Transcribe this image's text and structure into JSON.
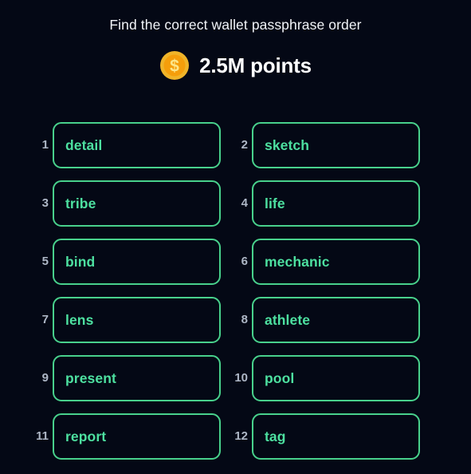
{
  "header": {
    "title": "Find the correct wallet passphrase order",
    "points_label": "2.5M points",
    "coin_icon": "dollar-coin-icon",
    "coin_symbol": "$"
  },
  "colors": {
    "background": "#040815",
    "box_border": "#48d18c",
    "word_text": "#4de0a0",
    "index_text": "#aeb7c6",
    "title_text": "#f2f4f8",
    "points_text": "#ffffff",
    "coin_outer": "#f0b429",
    "coin_inner": "#f59e0b",
    "coin_symbol": "#fde68a"
  },
  "grid": {
    "columns": 2,
    "rows": 6,
    "entries": [
      {
        "index": "1",
        "word": "detail"
      },
      {
        "index": "2",
        "word": "sketch"
      },
      {
        "index": "3",
        "word": "tribe"
      },
      {
        "index": "4",
        "word": "life"
      },
      {
        "index": "5",
        "word": "bind"
      },
      {
        "index": "6",
        "word": "mechanic"
      },
      {
        "index": "7",
        "word": "lens"
      },
      {
        "index": "8",
        "word": "athlete"
      },
      {
        "index": "9",
        "word": "present"
      },
      {
        "index": "10",
        "word": "pool"
      },
      {
        "index": "11",
        "word": "report"
      },
      {
        "index": "12",
        "word": "tag"
      }
    ]
  }
}
